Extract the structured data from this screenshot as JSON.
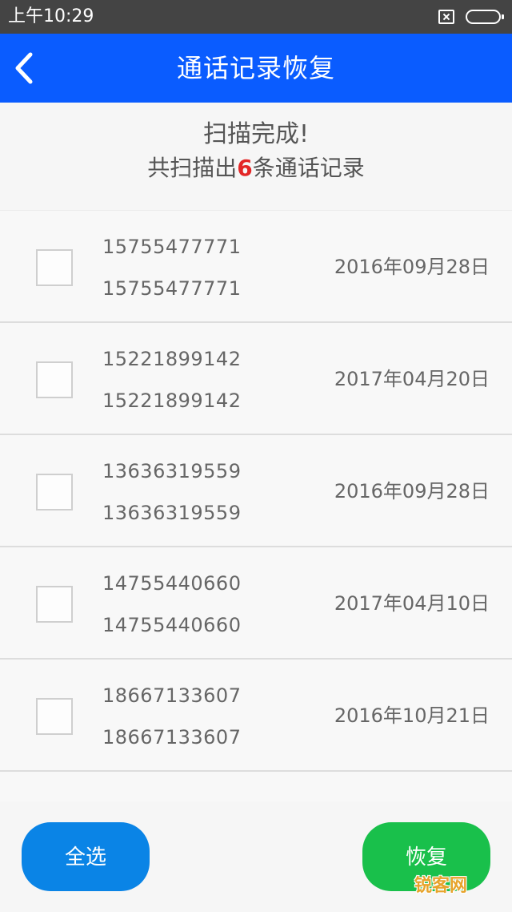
{
  "status_bar": {
    "time": "上午10:29",
    "icons": [
      "sim-card-icon",
      "battery-icon"
    ]
  },
  "header": {
    "title": "通话记录恢复",
    "back_icon": "chevron-left-icon",
    "background_color": "#0a5cff"
  },
  "summary": {
    "title": "扫描完成!",
    "count_prefix": "共扫描出",
    "count": "6",
    "count_suffix": "条通话记录",
    "count_color": "#e32727"
  },
  "records": [
    {
      "name": "15755477771",
      "number": "15755477771",
      "date": "2016年09月28日"
    },
    {
      "name": "15221899142",
      "number": "15221899142",
      "date": "2017年04月20日"
    },
    {
      "name": "13636319559",
      "number": "13636319559",
      "date": "2016年09月28日"
    },
    {
      "name": "14755440660",
      "number": "14755440660",
      "date": "2017年04月10日"
    },
    {
      "name": "18667133607",
      "number": "18667133607",
      "date": "2016年10月21日"
    }
  ],
  "actions": {
    "select_all_label": "全选",
    "restore_label": "恢复",
    "select_all_color": "#0a84e6",
    "restore_color": "#19c04b"
  },
  "watermark": {
    "text": "锐客网"
  }
}
